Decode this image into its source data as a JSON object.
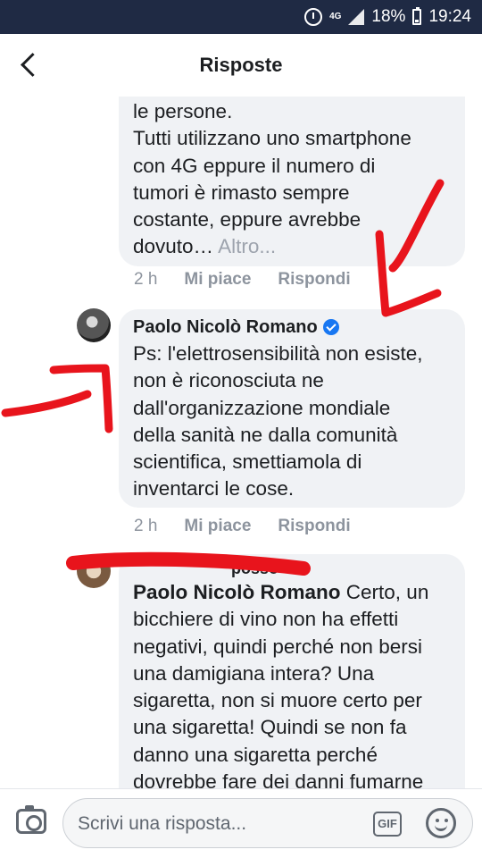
{
  "status_bar": {
    "network": "4G",
    "battery": "18%",
    "time": "19:24"
  },
  "header": {
    "title": "Risposte"
  },
  "comments": [
    {
      "author": "",
      "lines": [
        "le persone.",
        "Tutti utilizzano uno smartphone",
        "con 4G eppure il numero di",
        "tumori è rimasto sempre",
        "costante, eppure avrebbe",
        "dovuto…"
      ],
      "more_label": "Altro...",
      "time": "2 h",
      "like_label": "Mi piace",
      "reply_label": "Rispondi"
    },
    {
      "author": "Paolo Nicolò Romano",
      "lines": [
        "Ps: l'elettrosensibilità non esiste,",
        "non è riconosciuta ne",
        "dall'organizzazione mondiale",
        "della sanità ne dalla comunità",
        "scientifica, smettiamola di",
        "inventarci le cose."
      ],
      "time": "2 h",
      "like_label": "Mi piace",
      "reply_label": "Rispondi"
    },
    {
      "author_partial": "posso",
      "mention": "Paolo Nicolò Romano",
      "lines": [
        "Certo, un",
        "bicchiere di vino non ha effetti",
        "negativi, quindi perché non bersi",
        "una damigiana intera? Una",
        "sigaretta, non si muore certo per",
        "una sigaretta! Quindi se non fa",
        "danno una sigaretta perché",
        "dovrebbe fare dei danni fumarne"
      ]
    }
  ],
  "input_bar": {
    "placeholder": "Scrivi una risposta...",
    "gif_label": "GIF"
  }
}
